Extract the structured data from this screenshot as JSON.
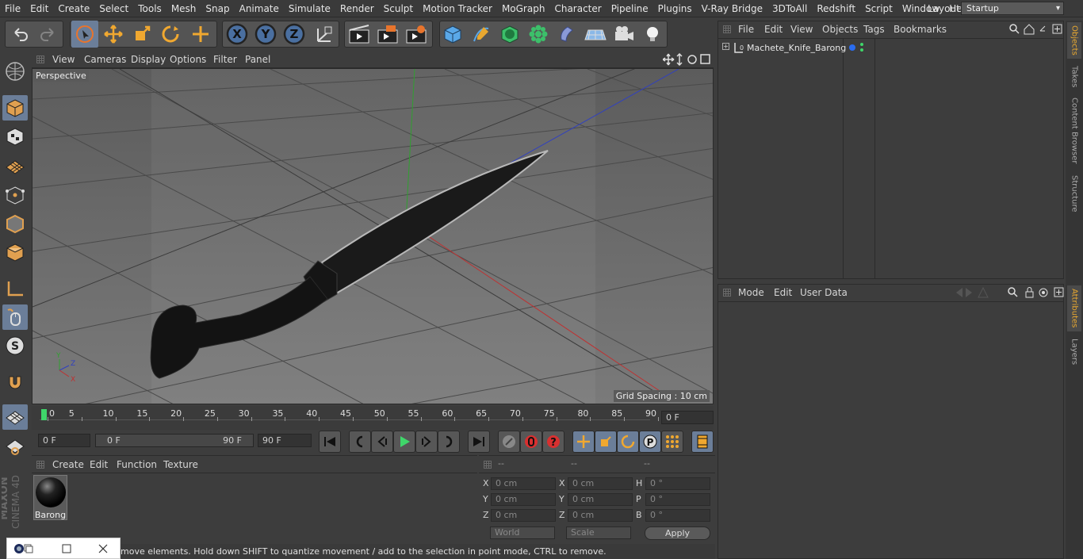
{
  "menu": [
    "File",
    "Edit",
    "Create",
    "Select",
    "Tools",
    "Mesh",
    "Snap",
    "Animate",
    "Simulate",
    "Render",
    "Sculpt",
    "Motion Tracker",
    "MoGraph",
    "Character",
    "Pipeline",
    "Plugins",
    "V-Ray Bridge",
    "3DToAll",
    "Redshift",
    "Script",
    "Window",
    "Help"
  ],
  "layout": {
    "label": "Layout:",
    "value": "Startup"
  },
  "viewport": {
    "menu": [
      "View",
      "Cameras",
      "Display",
      "Options",
      "Filter",
      "Panel"
    ],
    "camera": "Perspective",
    "grid_spacing": "Grid Spacing : 10 cm"
  },
  "timeline": {
    "ticks": [
      "0",
      "5",
      "10",
      "15",
      "20",
      "25",
      "30",
      "35",
      "40",
      "45",
      "50",
      "55",
      "60",
      "65",
      "70",
      "75",
      "80",
      "85",
      "90"
    ],
    "current_frame": "0 F"
  },
  "playbar": {
    "start": "0 F",
    "range_start": "0 F",
    "range_end": "90 F",
    "end": "90 F"
  },
  "material_manager": {
    "menu": [
      "Create",
      "Edit",
      "Function",
      "Texture"
    ],
    "materials": [
      {
        "name": "Barong"
      }
    ]
  },
  "coords": {
    "headers": [
      "--",
      "--",
      "--"
    ],
    "rows": [
      {
        "a": "X",
        "av": "0 cm",
        "b": "X",
        "bv": "0 cm",
        "c": "H",
        "cv": "0 °"
      },
      {
        "a": "Y",
        "av": "0 cm",
        "b": "Y",
        "bv": "0 cm",
        "c": "P",
        "cv": "0 °"
      },
      {
        "a": "Z",
        "av": "0 cm",
        "b": "Z",
        "bv": "0 cm",
        "c": "B",
        "cv": "0 °"
      }
    ],
    "mode": "World",
    "transform": "Scale",
    "apply": "Apply"
  },
  "object_manager": {
    "menu": [
      "File",
      "Edit",
      "View",
      "Objects",
      "Tags",
      "Bookmarks"
    ],
    "objects": [
      {
        "name": "Machete_Knife_Barong"
      }
    ]
  },
  "attribute_manager": {
    "menu": [
      "Mode",
      "Edit",
      "User Data"
    ]
  },
  "right_tabs": [
    "Objects",
    "Takes",
    "Content Browser",
    "Structure",
    "Attributes",
    "Layers"
  ],
  "status": "move elements. Hold down SHIFT to quantize movement / add to the selection in point mode, CTRL to remove.",
  "brand": {
    "line1": "MAXON",
    "line2": "CINEMA 4D"
  },
  "colors": {
    "accent": "#5a8fd8",
    "axis_x": "#c03030",
    "axis_y": "#30a030",
    "axis_z": "#3040c0"
  }
}
